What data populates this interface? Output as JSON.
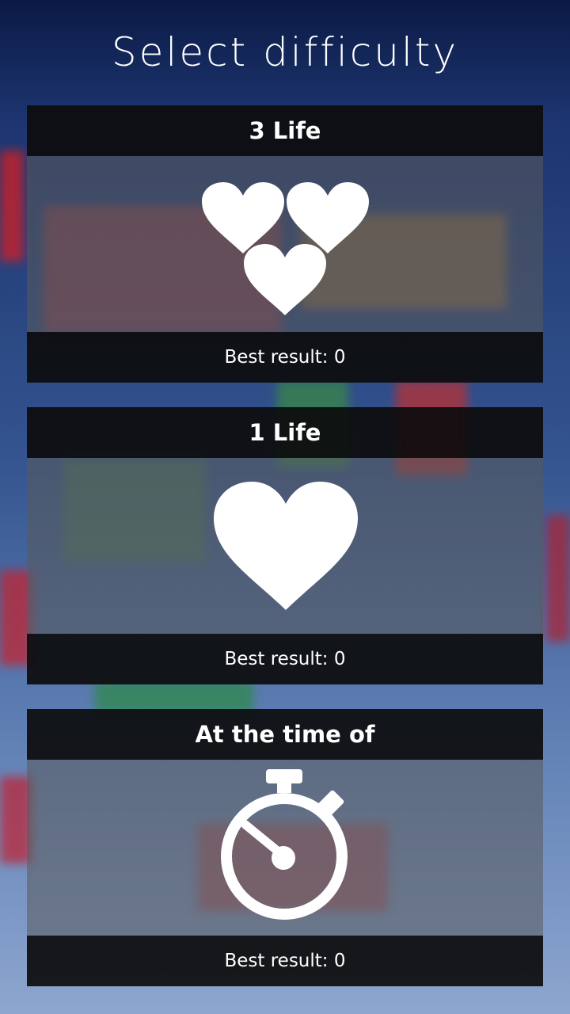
{
  "screen": {
    "title": "Select difficulty"
  },
  "modes": [
    {
      "name": "3 Life",
      "icon": "three-hearts-icon",
      "best_label": "Best result:",
      "best_value": "0"
    },
    {
      "name": "1 Life",
      "icon": "heart-icon",
      "best_label": "Best result:",
      "best_value": "0"
    },
    {
      "name": "At the time of",
      "icon": "stopwatch-icon",
      "best_label": "Best result:",
      "best_value": "0"
    }
  ],
  "colors": {
    "header_bg": "#0c0c0c",
    "body_bg": "#5a5a5a",
    "icon": "#ffffff"
  }
}
